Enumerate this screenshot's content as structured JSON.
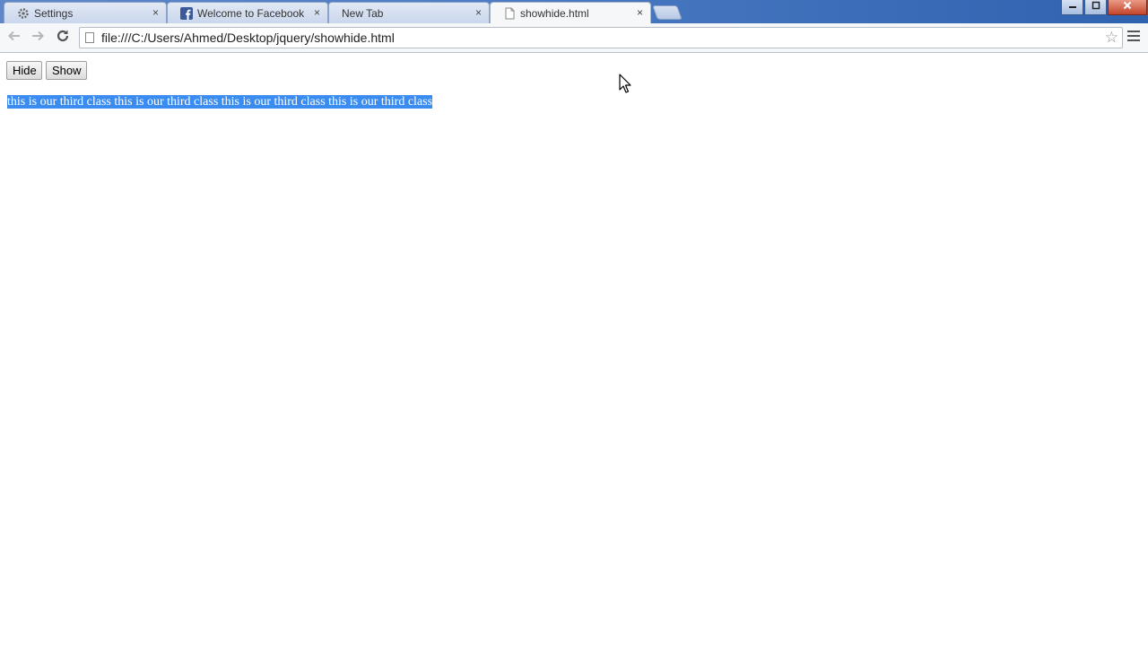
{
  "browser": {
    "tabs": [
      {
        "title": "Settings",
        "icon": "gear-icon",
        "active": false
      },
      {
        "title": "Welcome to Facebook - L",
        "icon": "facebook-icon",
        "active": false
      },
      {
        "title": "New Tab",
        "icon": "",
        "active": false
      },
      {
        "title": "showhide.html",
        "icon": "page-icon",
        "active": true
      }
    ],
    "tab_close_glyph": "×",
    "url": "file:///C:/Users/Ahmed/Desktop/jquery/showhide.html"
  },
  "page": {
    "hide_label": "Hide",
    "show_label": "Show",
    "paragraph": "this is our third class this is our third class this is our third class this is our third class"
  },
  "colors": {
    "selection": "#3a8cf0",
    "titlebar": "#4f7cc4"
  }
}
